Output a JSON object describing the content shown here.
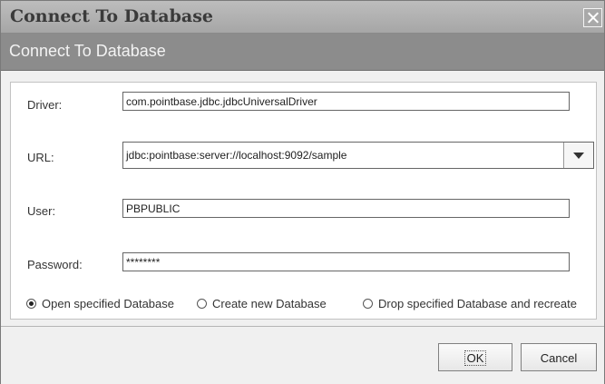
{
  "window": {
    "title": "Connect To Database"
  },
  "header": {
    "title": "Connect To Database"
  },
  "form": {
    "driver_label": "Driver:",
    "driver_value": "com.pointbase.jdbc.jdbcUniversalDriver",
    "url_label": "URL:",
    "url_value": "jdbc:pointbase:server://localhost:9092/sample",
    "user_label": "User:",
    "user_value": "PBPUBLIC",
    "password_label": "Password:",
    "password_value": "********"
  },
  "options": [
    {
      "label": "Open specified Database",
      "selected": true
    },
    {
      "label": "Create new Database",
      "selected": false
    },
    {
      "label": "Drop specified Database and recreate",
      "selected": false
    }
  ],
  "buttons": {
    "ok": "OK",
    "cancel": "Cancel"
  }
}
